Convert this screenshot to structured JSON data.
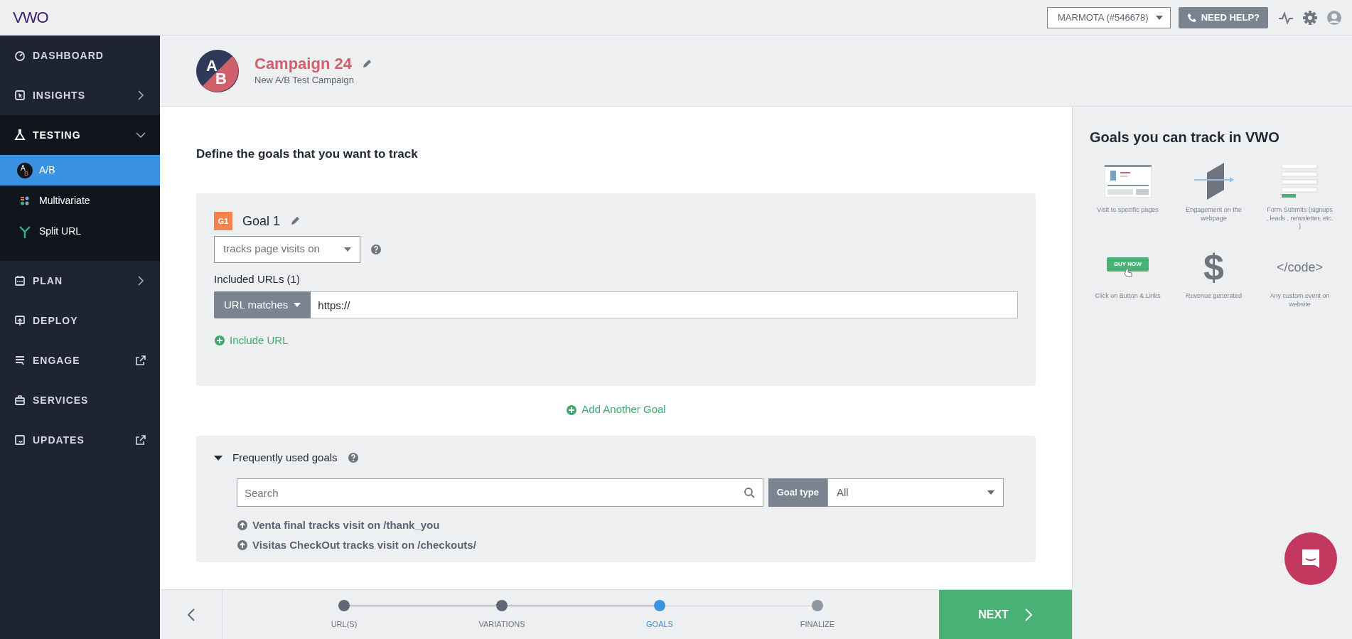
{
  "topbar": {
    "logo": "VWO",
    "account": "MARMOTA (#546678)",
    "help_button": "NEED HELP?"
  },
  "sidebar": {
    "items": [
      {
        "label": "DASHBOARD",
        "kind": "link"
      },
      {
        "label": "INSIGHTS",
        "kind": "group",
        "expanded": false
      },
      {
        "label": "TESTING",
        "kind": "group",
        "expanded": true,
        "children": [
          {
            "label": "A/B",
            "selected": true,
            "badge": [
              "A",
              "B"
            ]
          },
          {
            "label": "Multivariate",
            "selected": false
          },
          {
            "label": "Split URL",
            "selected": false
          }
        ]
      },
      {
        "label": "PLAN",
        "kind": "group",
        "expanded": false
      },
      {
        "label": "DEPLOY",
        "kind": "link"
      },
      {
        "label": "ENGAGE",
        "kind": "external"
      },
      {
        "label": "SERVICES",
        "kind": "link"
      },
      {
        "label": "UPDATES",
        "kind": "external"
      }
    ]
  },
  "campaign": {
    "avatar": [
      "A",
      "B"
    ],
    "title": "Campaign 24",
    "subtitle": "New A/B Test Campaign"
  },
  "section_title": "Define the goals that you want to track",
  "goals": [
    {
      "badge": "G1",
      "name": "Goal 1",
      "type_select": "tracks page visits on",
      "urls_label": "Included URLs (1)",
      "match_select": "URL matches",
      "url_value": "https://",
      "include_link": "Include URL"
    }
  ],
  "add_goal": "Add Another Goal",
  "frequent": {
    "title": "Frequently used goals",
    "expanded": true,
    "search_placeholder": "Search",
    "goal_type_label": "Goal type",
    "goal_type_value": "All",
    "items": [
      "Venta final tracks visit on /thank_you",
      "Visitas CheckOut tracks visit on /checkouts/"
    ]
  },
  "stepper": {
    "steps": [
      {
        "label": "URL(S)",
        "completed": true,
        "selected": false
      },
      {
        "label": "VARIATIONS",
        "completed": true,
        "selected": false
      },
      {
        "label": "GOALS",
        "completed": false,
        "selected": true
      },
      {
        "label": "FINALIZE",
        "completed": false,
        "selected": false
      }
    ],
    "next_button": "NEXT"
  },
  "help_panel": {
    "title": "Goals you can track in VWO",
    "tiles": [
      {
        "caption": "Visit to specific pages"
      },
      {
        "caption": "Engagement on the webpage"
      },
      {
        "caption": "Form Submits (signups , leads , newsletter, etc. )"
      },
      {
        "caption": "Click on Button & Links",
        "art_text": "BUY NOW"
      },
      {
        "caption": "Revenue generated",
        "art_text": "$"
      },
      {
        "caption": "Any custom event on website",
        "art_text": "</code>"
      }
    ]
  }
}
